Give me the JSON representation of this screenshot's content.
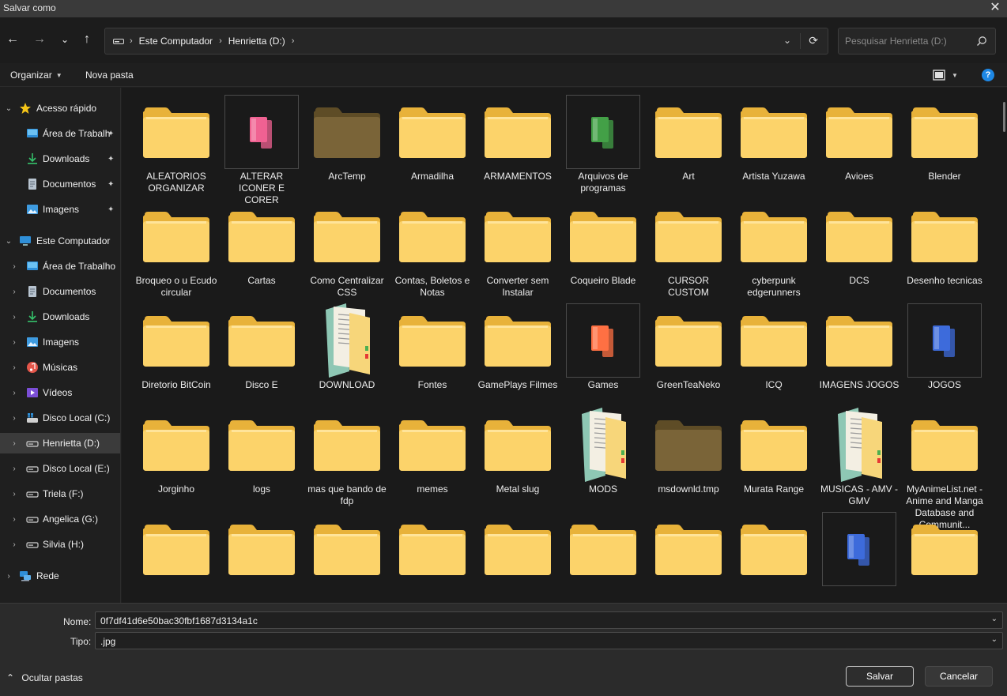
{
  "window": {
    "title": "Salvar como",
    "close_glyph": "✕"
  },
  "nav": {
    "back_glyph": "←",
    "forward_glyph": "→",
    "recent_glyph": "⌄",
    "up_glyph": "↑",
    "breadcrumb": [
      "Este Computador",
      "Henrietta (D:)"
    ],
    "sep_glyph": "›",
    "dropdown_glyph": "⌄",
    "refresh_glyph": "⟳",
    "search_placeholder": "Pesquisar Henrietta (D:)"
  },
  "toolbar": {
    "organize_label": "Organizar",
    "caret_glyph": "▼",
    "new_folder_label": "Nova pasta",
    "help_glyph": "?"
  },
  "sidebar": {
    "expand_glyph": "›",
    "collapse_glyph": "⌄",
    "pin_glyph": "📌",
    "quick_access": {
      "label": "Acesso rápido",
      "items": [
        "Área de Trabalh",
        "Downloads",
        "Documentos",
        "Imagens"
      ]
    },
    "this_pc": {
      "label": "Este Computador",
      "items": [
        "Área de Trabalho",
        "Documentos",
        "Downloads",
        "Imagens",
        "Músicas",
        "Vídeos",
        "Disco Local (C:)",
        "Henrietta (D:)",
        "Disco Local (E:)",
        "Triela (F:)",
        "Angelica  (G:)",
        "Silvia (H:)"
      ]
    },
    "network": {
      "label": "Rede"
    },
    "selected": "Henrietta (D:)"
  },
  "files": {
    "row1": [
      "ALEATORIOS ORGANIZAR",
      "ALTERAR ICONER E CORER",
      "ArcTemp",
      "Armadilha",
      "ARMAMENTOS",
      "Arquivos de programas",
      "Art",
      "Artista Yuzawa",
      "Avioes",
      "Blender"
    ],
    "row2": [
      "Broqueo o u Ecudo circular",
      "Cartas",
      "Como Centralizar CSS",
      "Contas, Boletos e Notas",
      "Converter sem Instalar",
      "Coqueiro Blade",
      "CURSOR CUSTOM",
      "cyberpunk edgerunners",
      "DCS",
      "Desenho tecnicas"
    ],
    "row3": [
      "Diretorio BitCoin",
      "Disco E",
      "DOWNLOAD",
      "Fontes",
      "GamePlays Filmes",
      "Games",
      "GreenTeaNeko",
      "ICQ",
      "IMAGENS JOGOS",
      "JOGOS"
    ],
    "row4": [
      "Jorginho",
      "logs",
      "mas que bando de fdp",
      "memes",
      "Metal slug",
      "MODS",
      "msdownld.tmp",
      "Murata Range",
      "MUSICAS - AMV - GMV",
      "MyAnimeList.net - Anime and Manga Database and Communit..."
    ]
  },
  "bottom": {
    "name_label": "Nome:",
    "name_value": "0f7df41d6e50bac30fbf1687d3134a1c",
    "type_label": "Tipo:",
    "type_value": ".jpg",
    "dropdown_glyph": "⌄",
    "hide_folders_glyph": "⌃",
    "hide_folders_label": "Ocultar pastas",
    "save_label": "Salvar",
    "cancel_label": "Cancelar"
  },
  "colors": {
    "folder_yellow": "#f8cf5a",
    "folder_yellow_light": "#ffe28a",
    "folder_dark": "#6e5a2e",
    "accent_blue": "#1e88e5",
    "pink_icon": "#f06292",
    "green_icon": "#43a047",
    "orange_icon": "#ff7043",
    "blue_icon": "#3d6bdb"
  }
}
